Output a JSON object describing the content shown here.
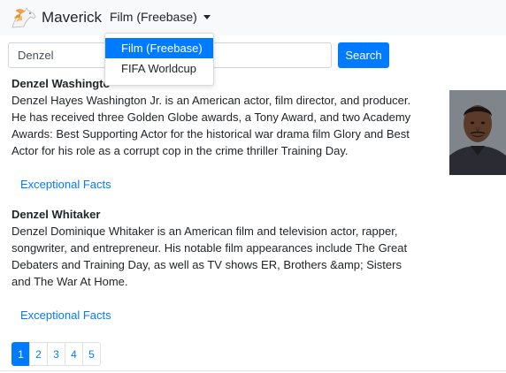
{
  "navbar": {
    "brand": "Maverick",
    "dataset_dropdown": "Film (Freebase)"
  },
  "dropdown_menu": {
    "items": [
      {
        "label": "Film (Freebase)",
        "active": true
      },
      {
        "label": "FIFA Worldcup",
        "active": false
      }
    ]
  },
  "search": {
    "value": "Denzel",
    "button_label": "Search"
  },
  "results": [
    {
      "name": "Denzel Washingto",
      "description": "Denzel Hayes Washington Jr. is an American actor, film director, and producer. He has received three Golden Globe awards, a Tony Award, and two Academy Awards: Best Supporting Actor for the historical war drama film Glory and Best Actor for his role as a corrupt cop in the crime thriller Training Day.",
      "link": "Exceptional Facts"
    },
    {
      "name": "Denzel Whitaker",
      "description": "Denzel Dominique Whitaker is an American film and television actor, rapper, songwriter, and entrepreneur. His notable film appearances include The Great Debaters and Training Day, as well as TV shows ER, Brothers &amp; Sisters and The War At Home.",
      "link": "Exceptional Facts"
    }
  ],
  "pagination": {
    "pages": [
      "1",
      "2",
      "3",
      "4",
      "5"
    ],
    "active_page": "1"
  },
  "colors": {
    "accent": "#007bff",
    "navbar_bg": "#f8f9fa",
    "text": "#212529"
  }
}
